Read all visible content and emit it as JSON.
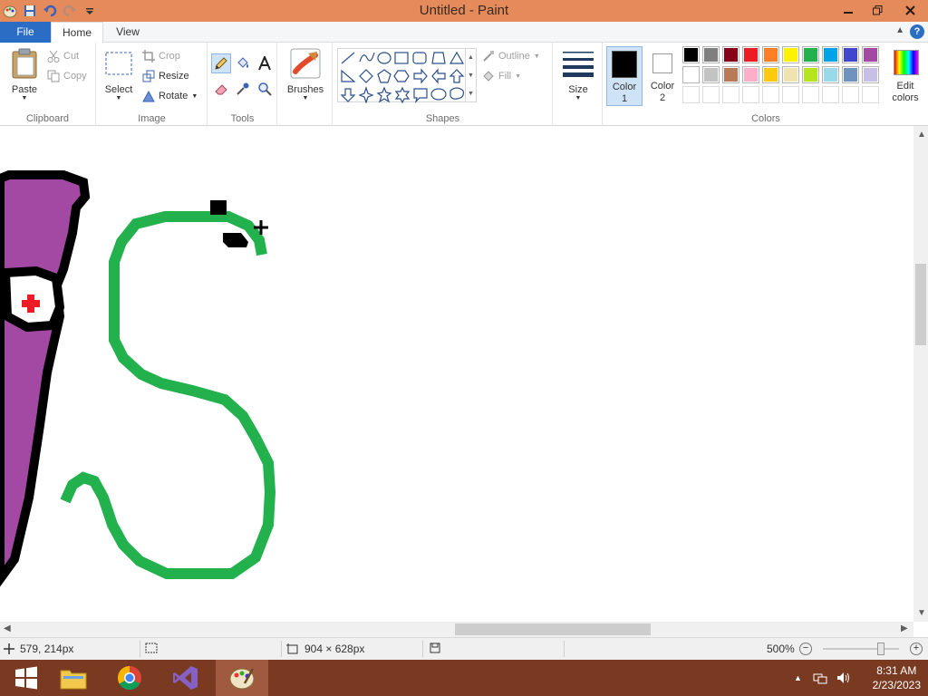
{
  "window": {
    "title": "Untitled - Paint"
  },
  "tabs": {
    "file": "File",
    "home": "Home",
    "view": "View"
  },
  "clipboard": {
    "paste": "Paste",
    "cut": "Cut",
    "copy": "Copy",
    "group": "Clipboard"
  },
  "image": {
    "select": "Select",
    "crop": "Crop",
    "resize": "Resize",
    "rotate": "Rotate",
    "group": "Image"
  },
  "tools": {
    "group": "Tools"
  },
  "brushes": {
    "label": "Brushes"
  },
  "shapes": {
    "outline": "Outline",
    "fill": "Fill",
    "group": "Shapes"
  },
  "size": {
    "label": "Size"
  },
  "colors": {
    "color1": "Color\n1",
    "color1_a": "Color",
    "color1_b": "1",
    "color2_a": "Color",
    "color2_b": "2",
    "edit_a": "Edit",
    "edit_b": "colors",
    "group": "Colors",
    "color1_value": "#000000",
    "color2_value": "#ffffff",
    "row1": [
      "#000000",
      "#7f7f7f",
      "#880015",
      "#ed1c24",
      "#ff7f27",
      "#fff200",
      "#22b14c",
      "#00a2e8",
      "#3f48cc",
      "#a349a4"
    ],
    "row2": [
      "#ffffff",
      "#c3c3c3",
      "#b97a57",
      "#ffaec9",
      "#ffc90e",
      "#efe4b0",
      "#b5e61d",
      "#99d9ea",
      "#7092be",
      "#c8bfe7"
    ]
  },
  "status": {
    "cursor_pos": "579, 214px",
    "canvas_size": "904 × 628px",
    "zoom": "500%"
  },
  "taskbar": {
    "time": "8:31 AM",
    "date": "2/23/2023"
  }
}
